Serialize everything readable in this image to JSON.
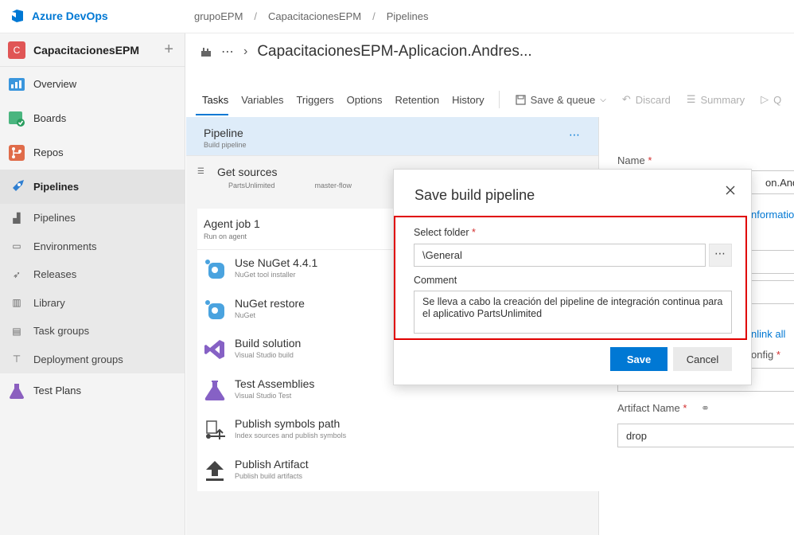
{
  "app": {
    "name": "Azure DevOps",
    "breadcrumb": [
      "grupoEPM",
      "CapacitacionesEPM",
      "Pipelines"
    ]
  },
  "sidebar": {
    "project": {
      "initial": "C",
      "name": "CapacitacionesEPM"
    },
    "items": [
      {
        "label": "Overview",
        "color": "#3a96dd"
      },
      {
        "label": "Boards",
        "color": "#2eb37a"
      },
      {
        "label": "Repos",
        "color": "#e06c4a"
      },
      {
        "label": "Pipelines",
        "color": "#2f7fd1"
      },
      {
        "label": "Test Plans",
        "color": "#8b5fbf"
      }
    ],
    "subitems": [
      {
        "label": "Pipelines",
        "icon": "pipelines-icon"
      },
      {
        "label": "Environments",
        "icon": "environments-icon"
      },
      {
        "label": "Releases",
        "icon": "releases-icon"
      },
      {
        "label": "Library",
        "icon": "library-icon"
      },
      {
        "label": "Task groups",
        "icon": "task-groups-icon"
      },
      {
        "label": "Deployment groups",
        "icon": "deployment-groups-icon"
      }
    ]
  },
  "header": {
    "title": "CapacitacionesEPM-Aplicacion.Andres..."
  },
  "tabs": [
    "Tasks",
    "Variables",
    "Triggers",
    "Options",
    "Retention",
    "History"
  ],
  "toolbar": {
    "save_queue": "Save & queue",
    "discard": "Discard",
    "summary": "Summary",
    "queue": "Q"
  },
  "tasks": {
    "pipeline": {
      "title": "Pipeline",
      "subtitle": "Build pipeline"
    },
    "get_sources": {
      "title": "Get sources",
      "repo": "PartsUnlimited",
      "branch": "master-flow"
    },
    "agent_job": {
      "title": "Agent job 1",
      "subtitle": "Run on agent"
    },
    "list": [
      {
        "title": "Use NuGet 4.4.1",
        "subtitle": "NuGet tool installer",
        "icon": "nuget-icon"
      },
      {
        "title": "NuGet restore",
        "subtitle": "NuGet",
        "icon": "nuget-icon"
      },
      {
        "title": "Build solution",
        "subtitle": "Visual Studio build",
        "icon": "visual-studio-icon"
      },
      {
        "title": "Test Assemblies",
        "subtitle": "Visual Studio Test",
        "icon": "flask-icon"
      },
      {
        "title": "Publish symbols path",
        "subtitle": "Index sources and publish symbols",
        "icon": "publish-symbols-icon"
      },
      {
        "title": "Publish Artifact",
        "subtitle": "Publish build artifacts",
        "icon": "upload-icon"
      }
    ]
  },
  "props": {
    "name_label": "Name",
    "name_value": "on.Andres",
    "info_link": "nformation",
    "unlink_all": "nlink all",
    "config_label": "onfig",
    "artifact_label": "Artifact Name",
    "artifact_value": "drop"
  },
  "dialog": {
    "title": "Save build pipeline",
    "folder_label": "Select folder",
    "folder_value": "\\General",
    "folder_browse": "⋯",
    "comment_label": "Comment",
    "comment_value": "Se lleva a cabo la creación del pipeline de integración continua para el aplicativo PartsUnlimited",
    "save": "Save",
    "cancel": "Cancel",
    "highlight_color": "#e00000"
  }
}
